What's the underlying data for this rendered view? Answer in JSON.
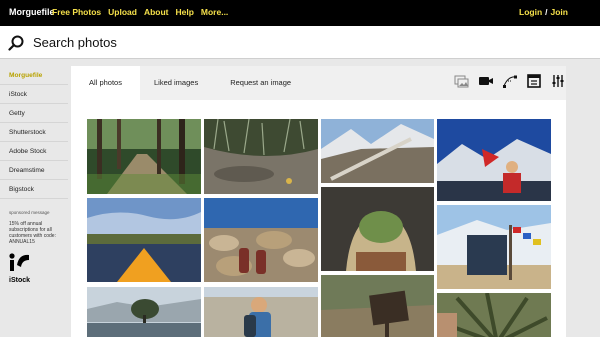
{
  "topnav": {
    "brand": "Morguefile",
    "links": [
      "Free Photos",
      "Upload",
      "About",
      "Help",
      "More..."
    ],
    "login": "Login",
    "separator": "/",
    "join": "Join"
  },
  "search": {
    "placeholder": "Search photos"
  },
  "sidebar": {
    "items": [
      {
        "label": "Morguefile",
        "active": true
      },
      {
        "label": "iStock",
        "active": false
      },
      {
        "label": "Getty",
        "active": false
      },
      {
        "label": "Shutterstock",
        "active": false
      },
      {
        "label": "Adobe Stock",
        "active": false
      },
      {
        "label": "Dreamstime",
        "active": false
      },
      {
        "label": "Bigstock",
        "active": false
      }
    ],
    "sponsored": "sponsored message",
    "offer": "15% off annual subscriptions for all customers with code: ANNUAL15",
    "istock_label": "iStock"
  },
  "tabs": [
    {
      "label": "All photos",
      "active": true
    },
    {
      "label": "Liked images",
      "active": false
    },
    {
      "label": "Request an image",
      "active": false
    }
  ],
  "toolbar_icons": [
    "photo-gallery-icon",
    "video-camera-icon",
    "vector-icon",
    "calendar-icon",
    "filter-sliders-icon"
  ],
  "colors": {
    "nav_bg": "#000000",
    "nav_link": "#f5e04b",
    "active_sidebar": "#b8a200"
  },
  "photos": [
    {
      "name": "photo-forest-path",
      "subject": "forest path with trees"
    },
    {
      "name": "photo-lake-kayak",
      "subject": "kayak bow on lake"
    },
    {
      "name": "photo-tree-lake",
      "subject": "tree on island in lake"
    },
    {
      "name": "photo-grass-puddle",
      "subject": "grass and puddle"
    },
    {
      "name": "photo-feet-rocks",
      "subject": "feet on rocks by water"
    },
    {
      "name": "photo-child-backpack",
      "subject": "child with backpack"
    },
    {
      "name": "photo-mountain-road",
      "subject": "mountain road"
    },
    {
      "name": "photo-cave-arch",
      "subject": "rock cave arch"
    },
    {
      "name": "photo-sign-bush",
      "subject": "wooden sign in bush"
    },
    {
      "name": "photo-flag-mountain",
      "subject": "person with flag in mountains"
    },
    {
      "name": "photo-prayer-flags",
      "subject": "prayer flags by lake"
    },
    {
      "name": "photo-palm-leaves",
      "subject": "palm leaves"
    }
  ]
}
